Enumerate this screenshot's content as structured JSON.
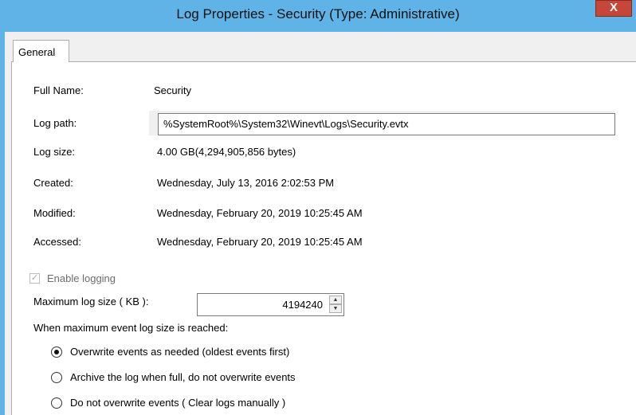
{
  "window": {
    "title": "Log Properties - Security (Type: Administrative)",
    "close_label": "X"
  },
  "tabs": [
    {
      "label": "General",
      "selected": true
    }
  ],
  "properties": {
    "full_name_label": "Full Name:",
    "full_name_value": "Security",
    "log_path_label": "Log path:",
    "log_path_value": "%SystemRoot%\\System32\\Winevt\\Logs\\Security.evtx",
    "log_size_label": "Log size:",
    "log_size_value": "4.00 GB(4,294,905,856 bytes)",
    "created_label": "Created:",
    "created_value": "Wednesday, July 13, 2016 2:02:53 PM",
    "modified_label": "Modified:",
    "modified_value": "Wednesday, February 20, 2019 10:25:45 AM",
    "accessed_label": "Accessed:",
    "accessed_value": "Wednesday, February 20, 2019 10:25:45 AM"
  },
  "logging": {
    "enable_label": "Enable logging",
    "enable_checked": true,
    "max_size_label": "Maximum log size ( KB ):",
    "max_size_value": "4194240",
    "when_reached_label": "When maximum event log size is reached:"
  },
  "retention_options": [
    {
      "label": "Overwrite events as needed (oldest events first)",
      "selected": true
    },
    {
      "label": "Archive the log when full, do not overwrite events",
      "selected": false
    },
    {
      "label": "Do not overwrite events ( Clear logs manually )",
      "selected": false
    }
  ],
  "colors": {
    "titlebar": "#5fb3e6",
    "close_button": "#c7463a"
  }
}
